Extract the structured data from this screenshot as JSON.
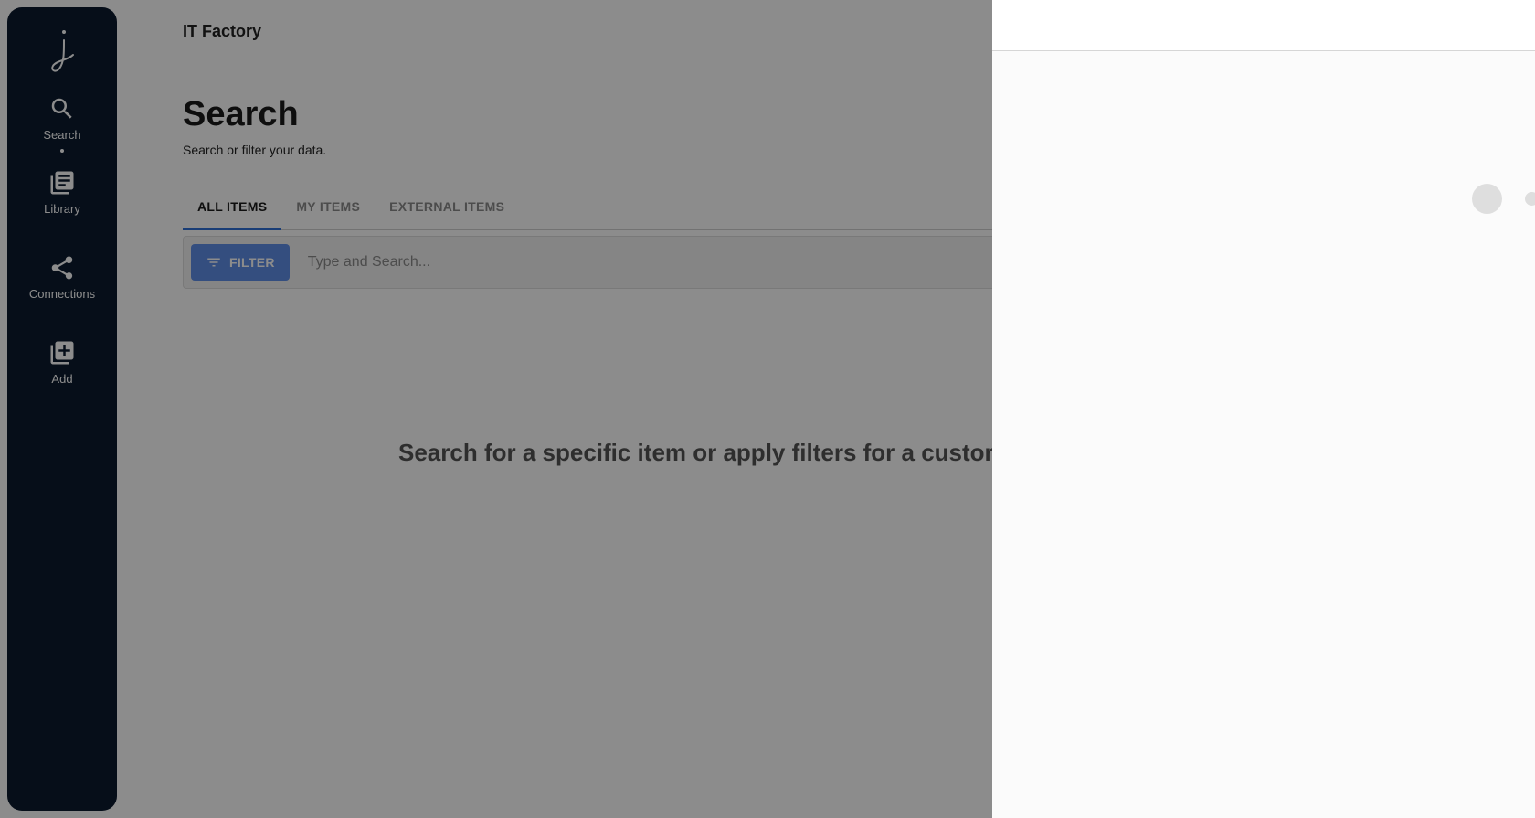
{
  "header": {
    "org_name": "IT Factory"
  },
  "sidebar": {
    "logo_icon": "script-j-logo",
    "items": [
      {
        "label": "Search",
        "icon": "search-icon",
        "active": true
      },
      {
        "label": "Library",
        "icon": "library-icon",
        "active": false
      },
      {
        "label": "Connections",
        "icon": "share-icon",
        "active": false
      },
      {
        "label": "Add",
        "icon": "add-box-icon",
        "active": false
      }
    ]
  },
  "page": {
    "title": "Search",
    "subtitle": "Search or filter your data."
  },
  "tabs": [
    {
      "label": "ALL ITEMS",
      "active": true
    },
    {
      "label": "MY ITEMS",
      "active": false
    },
    {
      "label": "EXTERNAL ITEMS",
      "active": false
    }
  ],
  "search": {
    "filter_label": "FILTER",
    "placeholder": "Type and Search..."
  },
  "empty_state": {
    "message": "Search for a specific item or apply filters for a custom v"
  },
  "colors": {
    "sidebar_bg": "#0b1a2e",
    "accent": "#2e6fd8",
    "filter_button": "#5f8fe8"
  }
}
